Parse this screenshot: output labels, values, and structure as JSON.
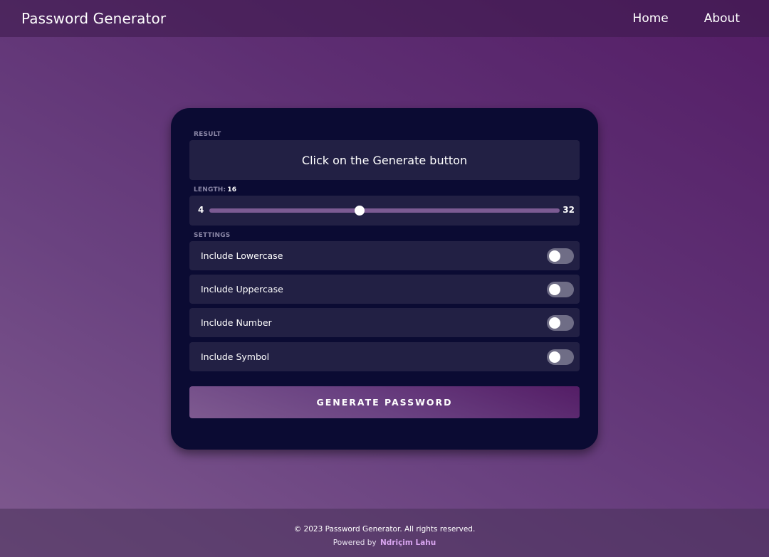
{
  "header": {
    "brand": "Password Generator",
    "nav": [
      {
        "label": "Home"
      },
      {
        "label": "About"
      }
    ]
  },
  "result": {
    "label": "RESULT",
    "placeholder": "Click on the Generate button"
  },
  "length": {
    "label": "LENGTH:",
    "value": "16",
    "min": "4",
    "max": "32"
  },
  "settings": {
    "label": "SETTINGS",
    "options": [
      {
        "label": "Include Lowercase",
        "enabled": false
      },
      {
        "label": "Include Uppercase",
        "enabled": false
      },
      {
        "label": "Include Number",
        "enabled": false
      },
      {
        "label": "Include Symbol",
        "enabled": false
      }
    ]
  },
  "generate_button": {
    "label": "GENERATE PASSWORD"
  },
  "footer": {
    "copyright": "© 2023 Password Generator. All rights reserved.",
    "powered_by": "Powered by",
    "author": "Ndriçim Lahu"
  },
  "colors": {
    "card_background": "#0b0b33",
    "panel_background": "#222044",
    "accent": "#7c5b93",
    "toggle_off": "#6f6d86",
    "author_link": "#d9a6f0"
  }
}
